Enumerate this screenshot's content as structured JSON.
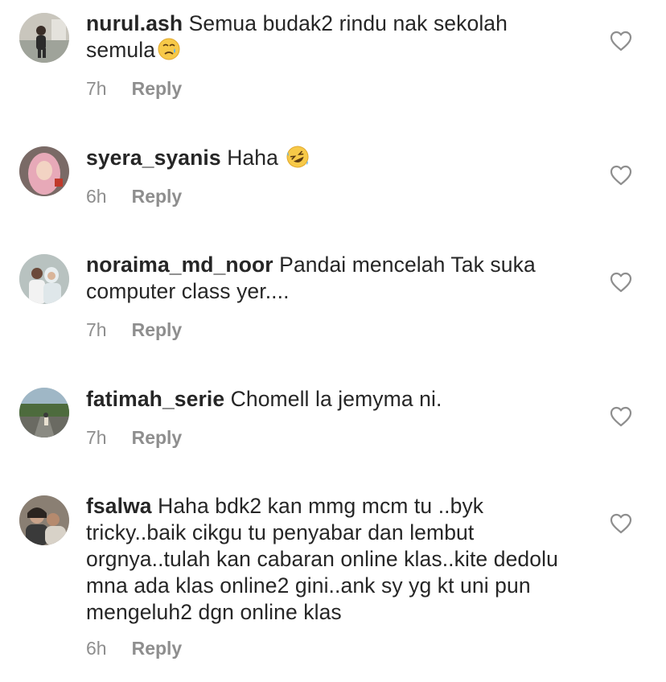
{
  "comments": [
    {
      "username": "nurul.ash",
      "text": "Semua budak2 rindu nak sekolah semula",
      "emoji": "crying-face-emoji",
      "time": "7h",
      "reply_label": "Reply",
      "avatar": "nurul-ash-avatar"
    },
    {
      "username": "syera_syanis",
      "text": "Haha",
      "emoji": "rofl-emoji",
      "time": "6h",
      "reply_label": "Reply",
      "avatar": "syera-syanis-avatar"
    },
    {
      "username": "noraima_md_noor",
      "text": "Pandai mencelah Tak suka computer class yer....",
      "emoji": "",
      "time": "7h",
      "reply_label": "Reply",
      "avatar": "noraima-md-noor-avatar"
    },
    {
      "username": "fatimah_serie",
      "text": "Chomell la jemyma ni.",
      "emoji": "",
      "time": "7h",
      "reply_label": "Reply",
      "avatar": "fatimah-serie-avatar"
    },
    {
      "username": "fsalwa",
      "text": "Haha bdk2 kan mmg mcm tu ..byk tricky..baik cikgu tu penyabar dan lembut orgnya..tulah kan cabaran online klas..kite dedolu mna ada klas online2 gini..ank sy yg kt uni pun mengeluh2 dgn online klas",
      "emoji": "",
      "time": "6h",
      "reply_label": "Reply",
      "avatar": "fsalwa-avatar"
    }
  ],
  "icons": {
    "like": "heart-outline-icon"
  },
  "colors": {
    "text": "#262626",
    "secondary": "#8e8e8e",
    "background": "#ffffff"
  }
}
